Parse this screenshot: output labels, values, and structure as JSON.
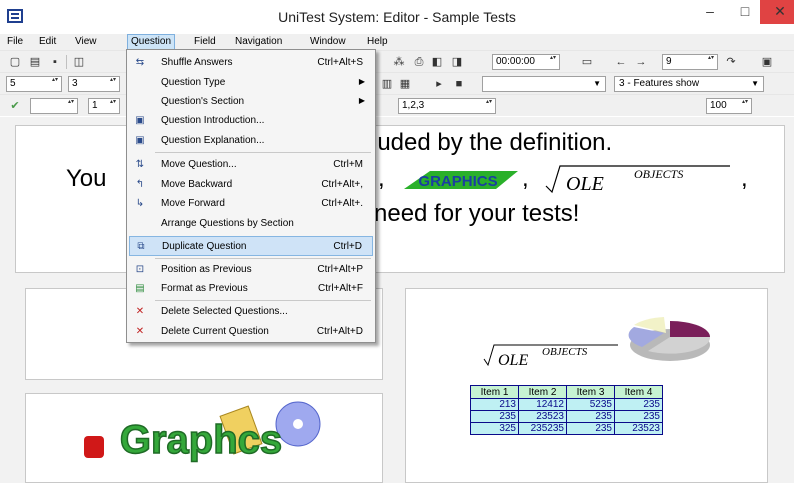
{
  "window": {
    "title": "UniTest System: Editor - Sample Tests",
    "minimize_glyph": "–",
    "maximize_glyph": "□",
    "close_glyph": "✕"
  },
  "menubar": [
    "File",
    "Edit",
    "View",
    "Question",
    "Field",
    "Navigation",
    "Window",
    "Help"
  ],
  "toolbar": {
    "timer": "00:00:00",
    "page_number": "9",
    "spin_a": "5",
    "spin_b": "3",
    "features_combo": "3 - Features show",
    "spin_c": "1",
    "answers_field": "1,2,3",
    "zoom": "100"
  },
  "question_menu": {
    "items": [
      {
        "icon": "shuffle-icon",
        "label": "Shuffle Answers",
        "shortcut": "Ctrl+Alt+S"
      },
      {
        "icon": "",
        "label": "Question Type",
        "shortcut": "",
        "submenu": true
      },
      {
        "icon": "",
        "label": "Question's Section",
        "shortcut": "",
        "submenu": true
      },
      {
        "icon": "introduction-icon",
        "label": "Question Introduction...",
        "shortcut": ""
      },
      {
        "icon": "explanation-icon",
        "label": "Question Explanation...",
        "shortcut": ""
      },
      {
        "icon": "move-question-icon",
        "label": "Move Question...",
        "shortcut": "Ctrl+M"
      },
      {
        "icon": "move-backward-icon",
        "label": "Move Backward",
        "shortcut": "Ctrl+Alt+,"
      },
      {
        "icon": "move-forward-icon",
        "label": "Move Forward",
        "shortcut": "Ctrl+Alt+."
      },
      {
        "icon": "",
        "label": "Arrange Questions by Section",
        "shortcut": ""
      },
      {
        "icon": "duplicate-icon",
        "label": "Duplicate Question",
        "shortcut": "Ctrl+D",
        "highlighted": true
      },
      {
        "icon": "position-icon",
        "label": "Position as Previous",
        "shortcut": "Ctrl+Alt+P"
      },
      {
        "icon": "format-icon",
        "label": "Format as Previous",
        "shortcut": "Ctrl+Alt+F"
      },
      {
        "icon": "delete-selected-icon",
        "label": "Delete Selected Questions...",
        "shortcut": ""
      },
      {
        "icon": "delete-current-icon",
        "label": "Delete Current Question",
        "shortcut": "Ctrl+Alt+D"
      }
    ]
  },
  "slide": {
    "line1": "luded by the definition.",
    "line2_start": "You",
    "comma": ",",
    "graphics_word": "GRAPHICS",
    "ole_text": "OLE",
    "ole_superscript": "OBJECTS",
    "line3": "need for your tests!",
    "graphs_word": "Graphcs"
  },
  "table": {
    "headers": [
      "Item 1",
      "Item 2",
      "Item 3",
      "Item 4"
    ],
    "rows": [
      [
        "213",
        "12412",
        "5235",
        "235"
      ],
      [
        "235",
        "23523",
        "235",
        "235"
      ],
      [
        "325",
        "235235",
        "235",
        "23523"
      ]
    ]
  },
  "colors": {
    "menu_highlight": "#cfe3f7",
    "close_button": "#e04343",
    "table_header": "#c6f3d3",
    "table_cell": "#bff0f3",
    "graphics_blue": "#1a3fa0",
    "graphics_green": "#2ab02a"
  }
}
